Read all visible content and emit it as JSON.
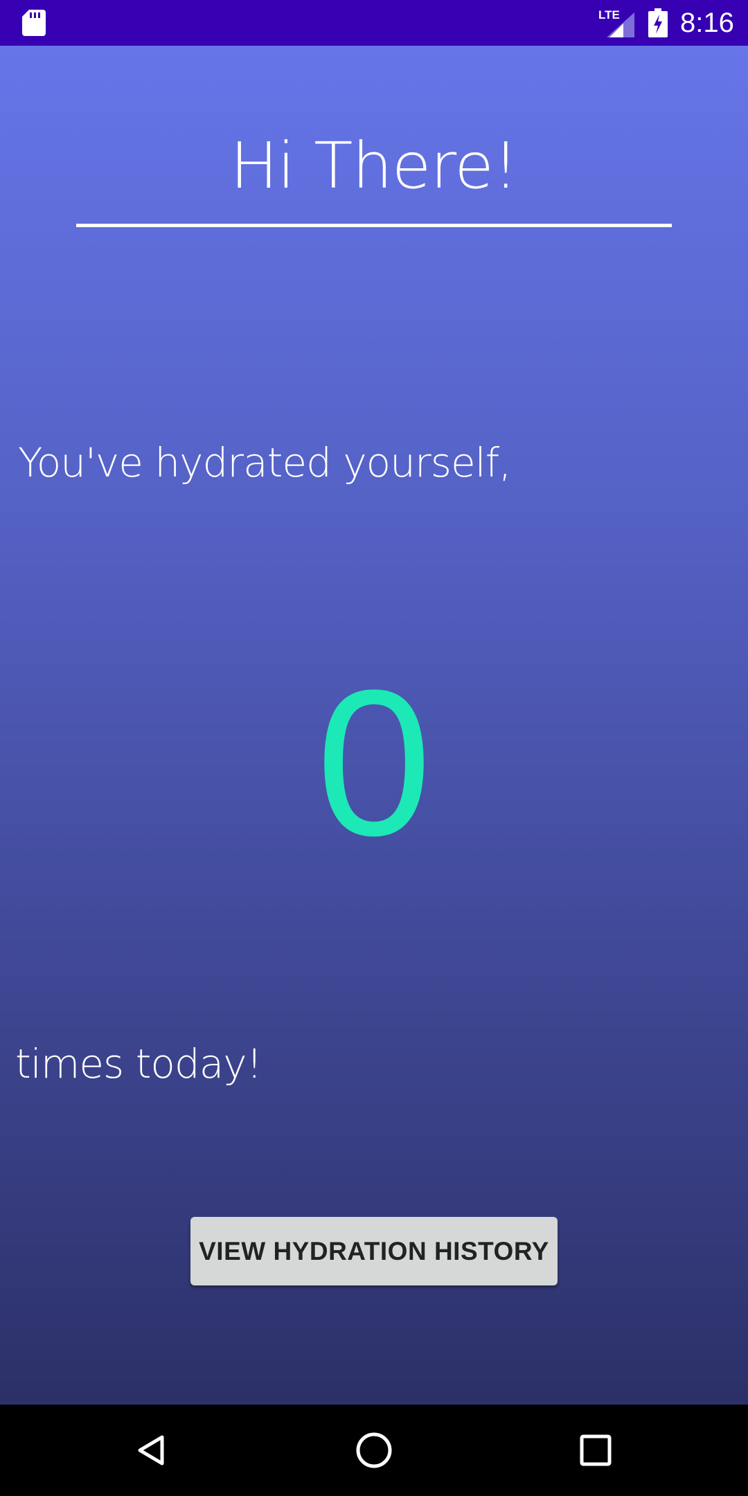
{
  "status_bar": {
    "network_label": "LTE",
    "time": "8:16",
    "icons": [
      "sd-card-icon",
      "lte-signal-icon",
      "battery-charging-icon"
    ]
  },
  "app": {
    "greeting": "Hi There!",
    "intro_text": "You've hydrated yourself,",
    "hydration_count": "0",
    "outro_text": "times today!",
    "history_button_label": "VIEW HYDRATION HISTORY"
  },
  "colors": {
    "status_bar": "#3700b3",
    "gradient_top": "#6675e8",
    "gradient_bottom": "#2c3068",
    "count_accent": "#1de9b6",
    "button_bg": "#d6d7d7"
  },
  "nav_bar": {
    "icons": [
      "back-icon",
      "home-icon",
      "recents-icon"
    ]
  }
}
